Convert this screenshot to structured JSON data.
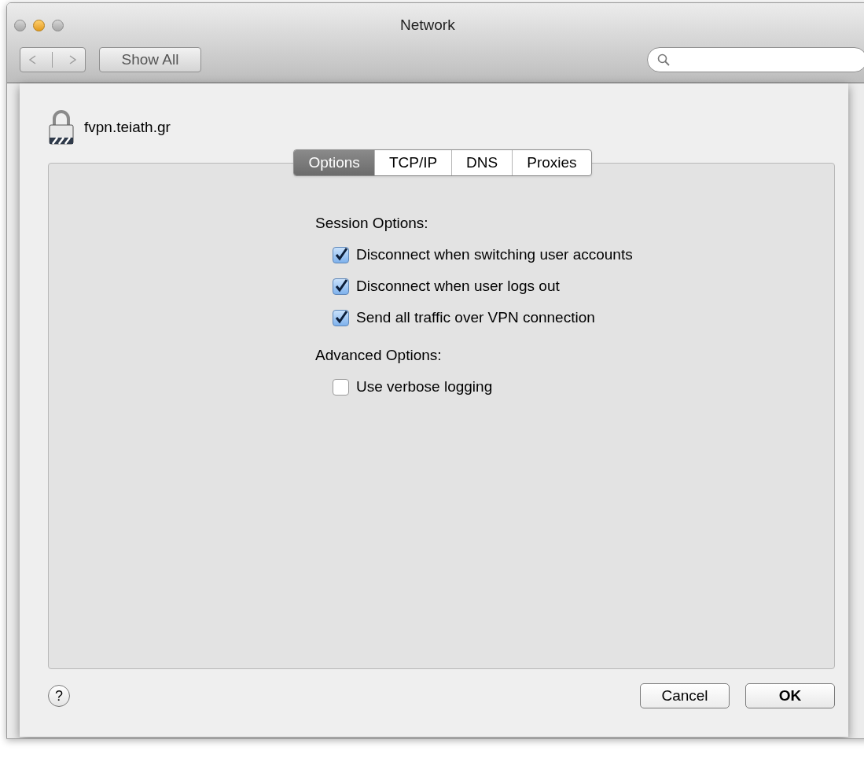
{
  "window": {
    "title": "Network"
  },
  "toolbar": {
    "show_all": "Show All"
  },
  "sheet": {
    "title": "fvpn.teiath.gr",
    "tabs": [
      {
        "label": "Options",
        "selected": true
      },
      {
        "label": "TCP/IP",
        "selected": false
      },
      {
        "label": "DNS",
        "selected": false
      },
      {
        "label": "Proxies",
        "selected": false
      }
    ],
    "sections": [
      {
        "heading": "Session Options:",
        "options": [
          {
            "label": "Disconnect when switching user accounts",
            "checked": true
          },
          {
            "label": "Disconnect when user logs out",
            "checked": true
          },
          {
            "label": "Send all traffic over VPN connection",
            "checked": true
          }
        ]
      },
      {
        "heading": "Advanced Options:",
        "options": [
          {
            "label": "Use verbose logging",
            "checked": false
          }
        ]
      }
    ],
    "help": "?",
    "buttons": [
      {
        "label": "Cancel",
        "kind": "cancel"
      },
      {
        "label": "OK",
        "kind": "default"
      }
    ]
  }
}
